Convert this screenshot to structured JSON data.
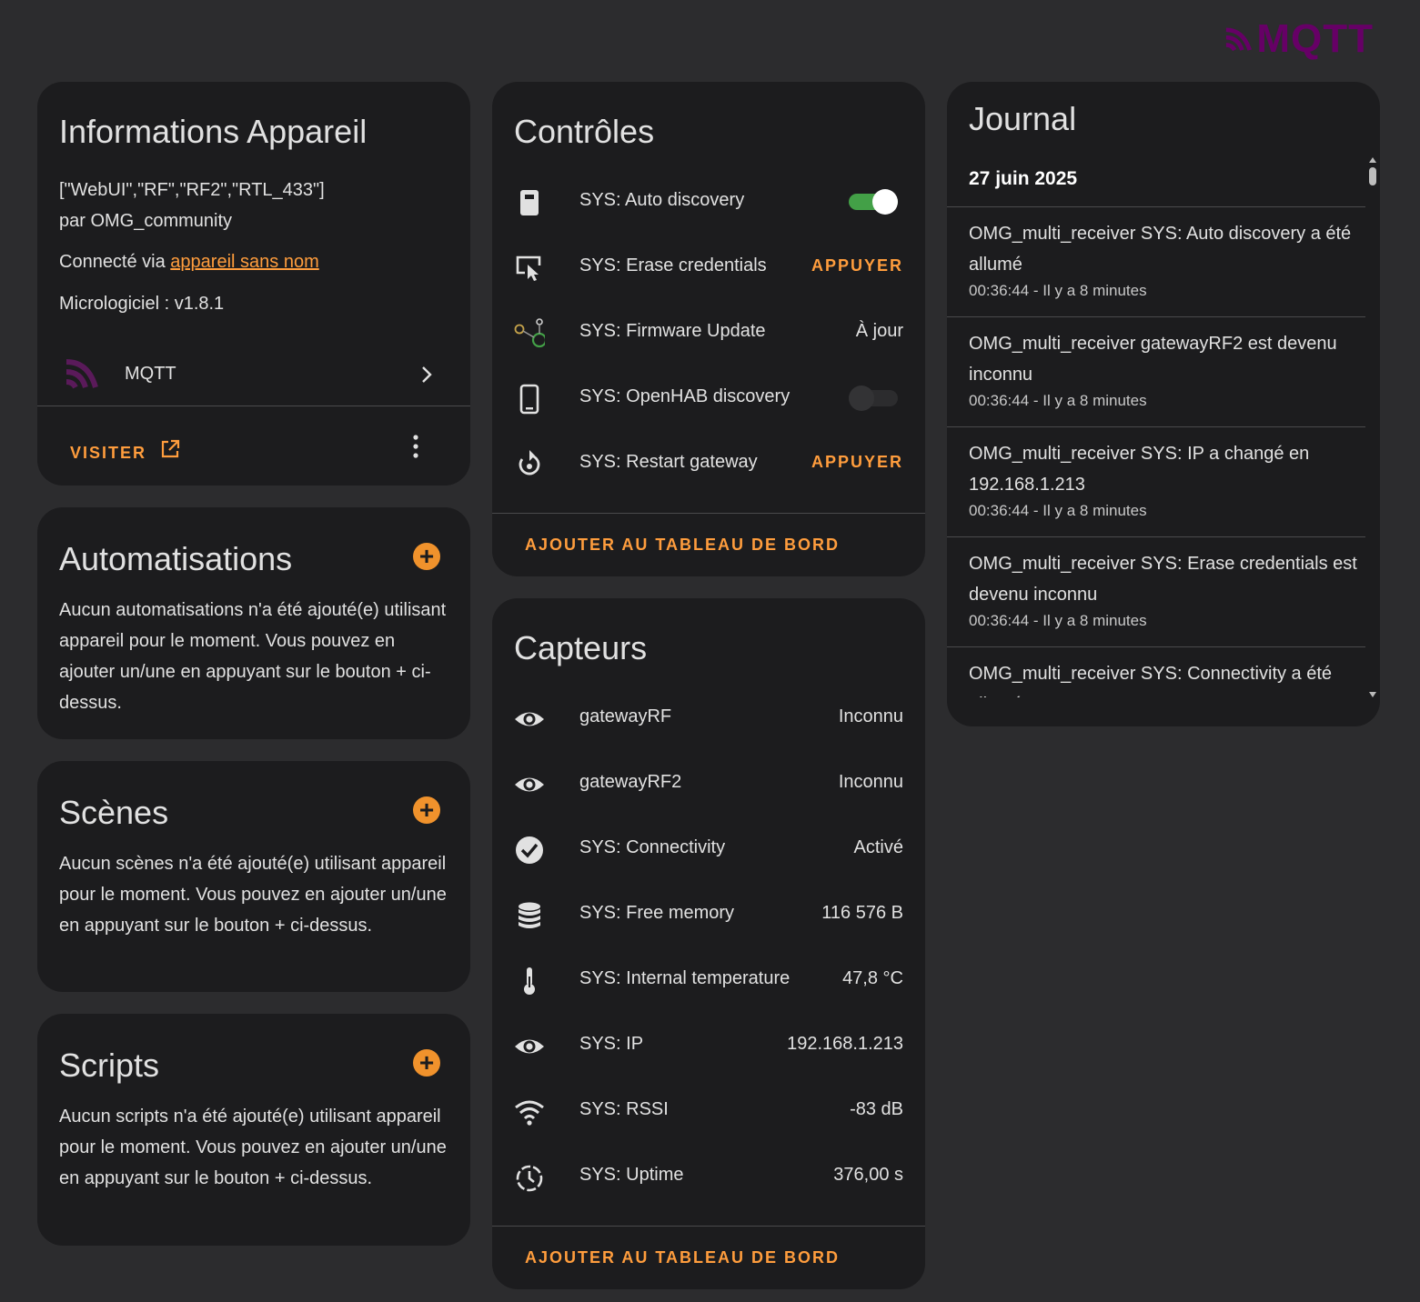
{
  "brand": {
    "logo_text": "MQTT",
    "logo_color": "#660066"
  },
  "colors": {
    "accent": "#ff9d3d",
    "toggle_on": "#43a047"
  },
  "device_info": {
    "title": "Informations Appareil",
    "capabilities": "[\"WebUI\",\"RF\",\"RF2\",\"RTL_433\"]",
    "manufacturer": "par OMG_community",
    "connected_prefix": "Connecté via ",
    "connected_link": "appareil sans nom",
    "firmware": "Micrologiciel : v1.8.1",
    "integration": "MQTT",
    "visit_label": "VISITER"
  },
  "automations": {
    "title": "Automatisations",
    "empty": "Aucun automatisations n'a été ajouté(e) utilisant appareil pour le moment. Vous pouvez en ajouter un/une en appuyant sur le bouton + ci-dessus."
  },
  "scenes": {
    "title": "Scènes",
    "empty": "Aucun scènes n'a été ajouté(e) utilisant appareil pour le moment. Vous pouvez en ajouter un/une en appuyant sur le bouton + ci-dessus."
  },
  "scripts": {
    "title": "Scripts",
    "empty": "Aucun scripts n'a été ajouté(e) utilisant appareil pour le moment. Vous pouvez en ajouter un/une en appuyant sur le bouton + ci-dessus."
  },
  "controls": {
    "title": "Contrôles",
    "add_dashboard": "AJOUTER AU TABLEAU DE BORD",
    "items": [
      {
        "icon": "remote-icon",
        "label": "SYS: Auto discovery",
        "kind": "toggle",
        "state": "on"
      },
      {
        "icon": "erase-icon",
        "label": "SYS: Erase credentials",
        "kind": "button",
        "action": "APPUYER"
      },
      {
        "icon": "update-icon",
        "label": "SYS: Firmware Update",
        "kind": "value",
        "value": "À jour"
      },
      {
        "icon": "phone-icon",
        "label": "SYS: OpenHAB discovery",
        "kind": "toggle",
        "state": "off"
      },
      {
        "icon": "restart-icon",
        "label": "SYS: Restart gateway",
        "kind": "button",
        "action": "APPUYER"
      }
    ]
  },
  "sensors": {
    "title": "Capteurs",
    "add_dashboard": "AJOUTER AU TABLEAU DE BORD",
    "items": [
      {
        "icon": "eye-icon",
        "label": "gatewayRF",
        "value": "Inconnu"
      },
      {
        "icon": "eye-icon",
        "label": "gatewayRF2",
        "value": "Inconnu"
      },
      {
        "icon": "check-circle-icon",
        "label": "SYS: Connectivity",
        "value": "Activé"
      },
      {
        "icon": "database-icon",
        "label": "SYS: Free memory",
        "value": "116 576 B"
      },
      {
        "icon": "thermometer-icon",
        "label": "SYS: Internal temperature",
        "value": "47,8 °C"
      },
      {
        "icon": "eye-icon",
        "label": "SYS: IP",
        "value": "192.168.1.213"
      },
      {
        "icon": "wifi-icon",
        "label": "SYS: RSSI",
        "value": "-83 dB"
      },
      {
        "icon": "timer-icon",
        "label": "SYS: Uptime",
        "value": "376,00 s"
      }
    ]
  },
  "journal": {
    "title": "Journal",
    "date": "27 juin 2025",
    "entries": [
      {
        "message": "OMG_multi_receiver SYS: Auto discovery a été allumé",
        "time": "00:36:44 - Il y a 8 minutes"
      },
      {
        "message": "OMG_multi_receiver gatewayRF2 est devenu inconnu",
        "time": "00:36:44 - Il y a 8 minutes"
      },
      {
        "message": "OMG_multi_receiver SYS: IP a changé en 192.168.1.213",
        "time": "00:36:44 - Il y a 8 minutes"
      },
      {
        "message": "OMG_multi_receiver SYS: Erase credentials est devenu inconnu",
        "time": "00:36:44 - Il y a 8 minutes"
      },
      {
        "message": "OMG_multi_receiver SYS: Connectivity a été allumé",
        "time": ""
      }
    ]
  }
}
